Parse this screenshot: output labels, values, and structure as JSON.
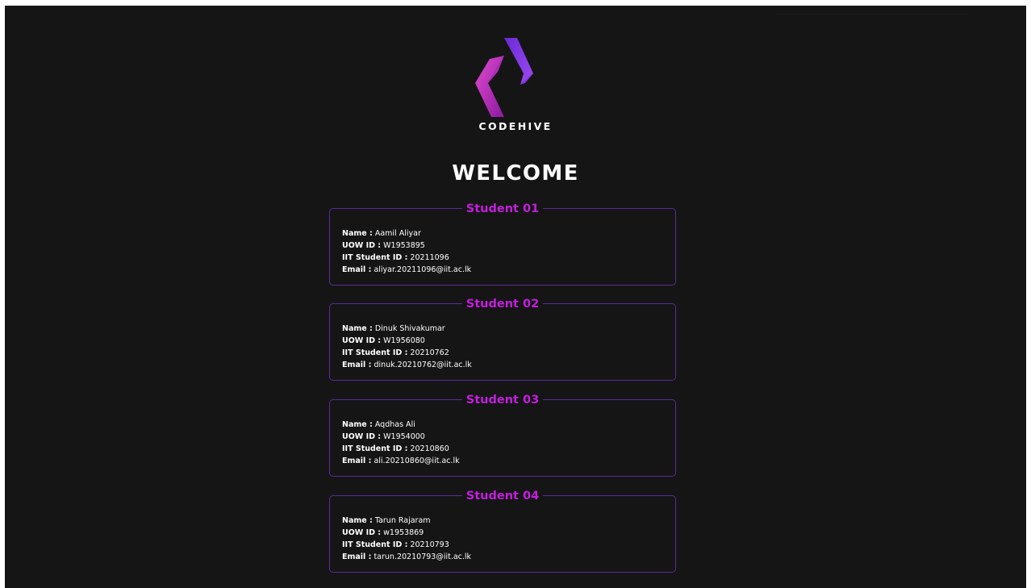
{
  "brand": {
    "name": "CODEHIVE"
  },
  "heading": "WELCOME",
  "students": [
    {
      "title": "Student 01",
      "name_label": "Name :",
      "name": "Aamil Aliyar",
      "uow_label": "UOW ID :",
      "uow": "W1953895",
      "iit_label": "IIT Student ID :",
      "iit": "20211096",
      "email_label": "Email :",
      "email": "aliyar.20211096@iit.ac.lk"
    },
    {
      "title": "Student 02",
      "name_label": "Name :",
      "name": "Dinuk Shivakumar",
      "uow_label": "UOW ID :",
      "uow": "W1956080",
      "iit_label": "IIT Student ID :",
      "iit": "20210762",
      "email_label": "Email :",
      "email": "dinuk.20210762@iit.ac.lk"
    },
    {
      "title": "Student 03",
      "name_label": "Name :",
      "name": "Aqdhas Ali",
      "uow_label": "UOW ID :",
      "uow": "W1954000",
      "iit_label": "IIT Student ID :",
      "iit": "20210860",
      "email_label": "Email :",
      "email": "ali.20210860@iit.ac.lk"
    },
    {
      "title": "Student 04",
      "name_label": "Name :",
      "name": "Tarun Rajaram",
      "uow_label": "UOW ID :",
      "uow": "w1953869",
      "iit_label": "IIT Student ID :",
      "iit": "20210793",
      "email_label": "Email :",
      "email": "tarun.20210793@iit.ac.lk"
    }
  ],
  "colors": {
    "background": "#151515",
    "accent": "#c21fdc",
    "card_border": "#5b2a9a",
    "text": "#ffffff"
  }
}
